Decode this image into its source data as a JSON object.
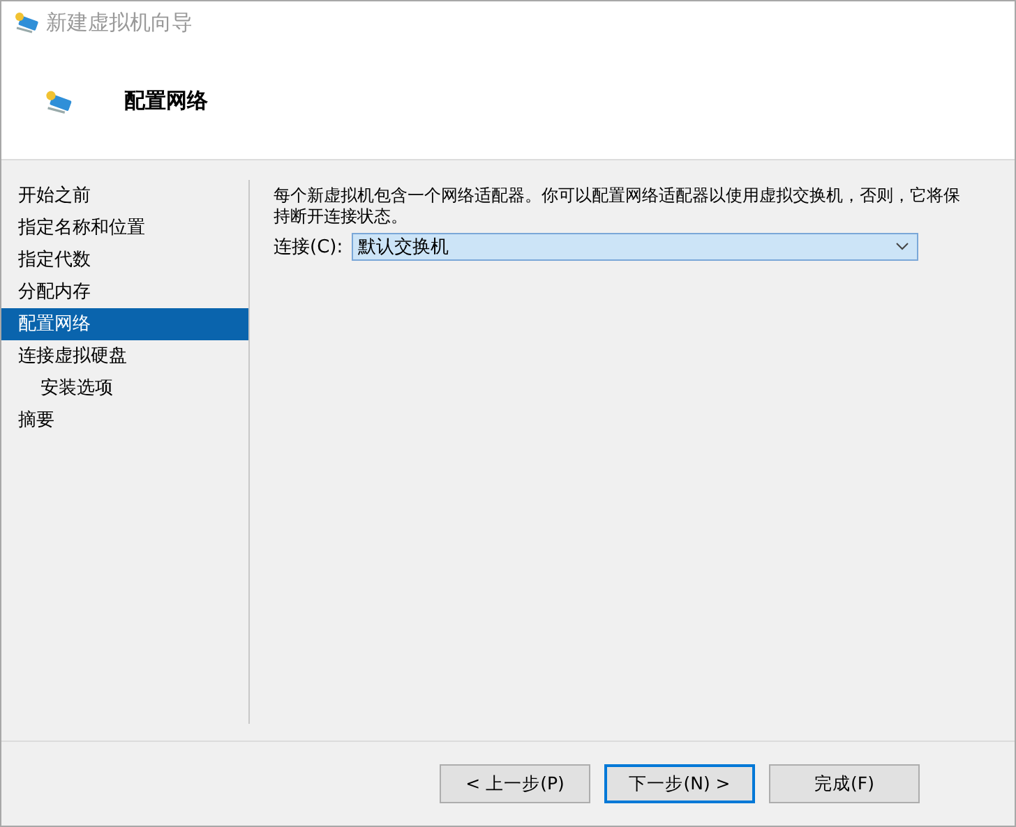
{
  "window": {
    "title": "新建虚拟机向导"
  },
  "header": {
    "title": "配置网络"
  },
  "sidebar": {
    "items": [
      {
        "label": "开始之前",
        "selected": false
      },
      {
        "label": "指定名称和位置",
        "selected": false
      },
      {
        "label": "指定代数",
        "selected": false
      },
      {
        "label": "分配内存",
        "selected": false
      },
      {
        "label": "配置网络",
        "selected": true
      },
      {
        "label": "连接虚拟硬盘",
        "selected": false,
        "children": [
          {
            "label": "安装选项",
            "selected": false
          }
        ]
      },
      {
        "label": "摘要",
        "selected": false
      }
    ]
  },
  "content": {
    "description": "每个新虚拟机包含一个网络适配器。你可以配置网络适配器以使用虚拟交换机，否则，它将保持断开连接状态。",
    "connection": {
      "label": "连接(C):",
      "value": "默认交换机"
    }
  },
  "buttons": [
    {
      "label": "< 上一步(P)",
      "default": false
    },
    {
      "label": "下一步(N) >",
      "default": true
    },
    {
      "label": "完成(F)",
      "default": false
    }
  ]
}
